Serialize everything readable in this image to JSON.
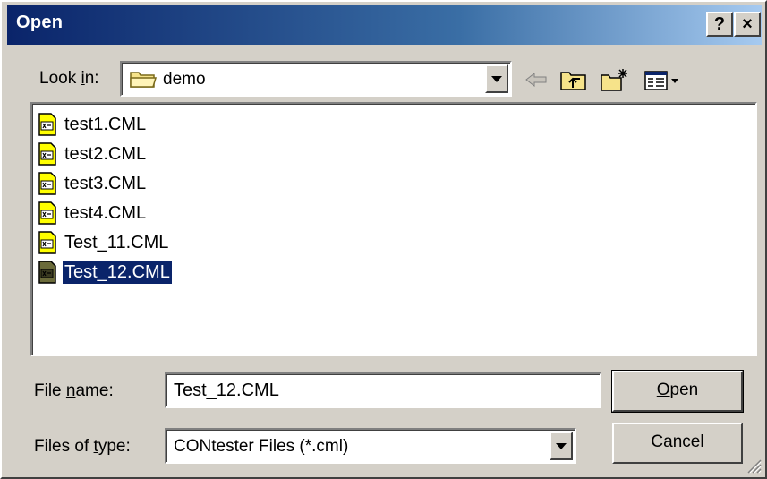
{
  "window": {
    "title": "Open",
    "help_label": "?",
    "close_label": "×"
  },
  "lookin": {
    "label_pre": "Look ",
    "label_ul": "i",
    "label_post": "n:",
    "value": "demo"
  },
  "files": [
    {
      "name": "test1.CML",
      "selected": false
    },
    {
      "name": "test2.CML",
      "selected": false
    },
    {
      "name": "test3.CML",
      "selected": false
    },
    {
      "name": "test4.CML",
      "selected": false
    },
    {
      "name": "Test_11.CML",
      "selected": false
    },
    {
      "name": "Test_12.CML",
      "selected": true
    }
  ],
  "filename": {
    "label_pre": "File ",
    "label_ul": "n",
    "label_post": "ame:",
    "value": "Test_12.CML"
  },
  "filetype": {
    "label_pre": "Files of ",
    "label_ul": "t",
    "label_post": "ype:",
    "value": "CONtester Files (*.cml)"
  },
  "buttons": {
    "open_ul": "O",
    "open_rest": "pen",
    "cancel": "Cancel"
  },
  "colors": {
    "title_start": "#0a246a",
    "title_end": "#a6caf0",
    "face": "#d4d0c8",
    "selection": "#0a246a",
    "file_icon": "#ffff00"
  },
  "icons": {
    "back": "back-arrow-icon",
    "up": "up-folder-icon",
    "new_folder": "new-folder-icon",
    "view": "view-menu-icon"
  }
}
